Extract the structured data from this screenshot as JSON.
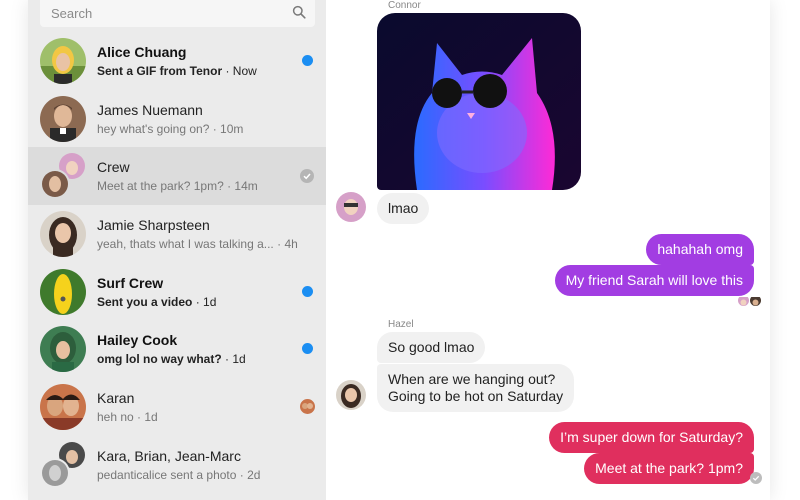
{
  "search": {
    "placeholder": "Search"
  },
  "chats": [
    {
      "name": "Alice Chuang",
      "preview": "Sent a GIF from Tenor",
      "time": "Now",
      "unread": true,
      "status": "unread-dot"
    },
    {
      "name": "James Nuemann",
      "preview": "hey what's going on?",
      "time": "10m",
      "unread": false,
      "status": ""
    },
    {
      "name": "Crew",
      "preview": "Meet at the park? 1pm?",
      "time": "14m",
      "unread": false,
      "status": "seen-check",
      "selected": true
    },
    {
      "name": "Jamie Sharpsteen",
      "preview": "yeah, thats what I was talking a...",
      "time": "4h",
      "unread": false,
      "status": ""
    },
    {
      "name": "Surf Crew",
      "preview": "Sent you a video",
      "time": "1d",
      "unread": true,
      "status": "unread-dot"
    },
    {
      "name": "Hailey Cook",
      "preview": "omg lol no way what?",
      "time": "1d",
      "unread": true,
      "status": "unread-dot"
    },
    {
      "name": "Karan",
      "preview": "heh no",
      "time": "1d",
      "unread": false,
      "status": "seen-avatar"
    },
    {
      "name": "Kara, Brian, Jean-Marc",
      "preview": "pedanticalice sent a photo",
      "time": "2d",
      "unread": false,
      "status": ""
    }
  ],
  "conversation": {
    "sender_connor": "Connor",
    "msg_lmao": "lmao",
    "msg_hahahah": "hahahah omg",
    "msg_sarah": "My friend Sarah will love this",
    "sender_hazel": "Hazel",
    "msg_so_good": "So good lmao",
    "msg_hanging_1": "When are we hanging out?",
    "msg_hanging_2": "Going to be hot on Saturday",
    "msg_super_down": "I’m super down for Saturday?",
    "msg_meet_park": "Meet at the park? 1pm?"
  },
  "colors": {
    "accent_blue": "#1b8ef2",
    "bubble_purple": "#a23de2",
    "bubble_pink": "#e02f5e",
    "bubble_incoming": "#f1f1f1",
    "sidebar_bg": "#ebebeb",
    "selected_bg": "#dcdcdc"
  },
  "icons": {
    "search": "search-icon",
    "seen": "check-circle-icon"
  }
}
